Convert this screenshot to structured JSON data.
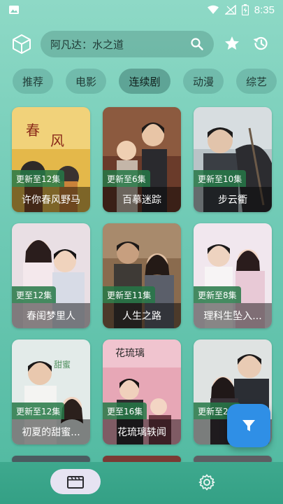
{
  "status_bar": {
    "time": "8:35"
  },
  "search": {
    "text": "阿凡达：水之道"
  },
  "categories": [
    "推荐",
    "电影",
    "连续剧",
    "动漫",
    "综艺"
  ],
  "selected_category": "连续剧",
  "cards": [
    {
      "title": "许你春风野马",
      "badge": "更新至12集"
    },
    {
      "title": "百摹迷踪",
      "badge": "更新至6集"
    },
    {
      "title": "步云衢",
      "badge": "更新至10集"
    },
    {
      "title": "春闺梦里人",
      "badge": "更至12集"
    },
    {
      "title": "人生之路",
      "badge": "更新至11集"
    },
    {
      "title": "理科生坠入...",
      "badge": "更新至8集"
    },
    {
      "title": "初夏的甜蜜...",
      "badge": "更新至12集"
    },
    {
      "title": "花琉璃轶闻",
      "badge": "更至16集"
    },
    {
      "title": "...",
      "badge": "更新至2..."
    }
  ],
  "icons": {
    "logo": "cube-icon",
    "search": "search-icon",
    "favorites": "star-icon",
    "history": "history-icon",
    "filter": "filter-icon",
    "nav_film": "film-icon",
    "nav_settings": "gear-icon"
  },
  "colors": {
    "background_top": "#8ed9c6",
    "background_bottom": "#4fb89f",
    "badge": "#267846",
    "fab": "#2f8fe6",
    "nav_active_pill": "#e6e3f2"
  }
}
